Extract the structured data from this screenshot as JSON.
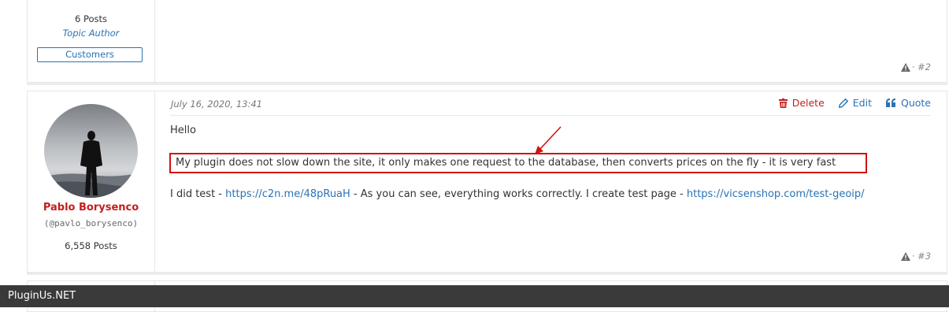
{
  "post_prev": {
    "posts_count": "6 Posts",
    "role": "Topic Author",
    "badge": "Customers",
    "number": "· #2"
  },
  "post_main": {
    "date": "July 16, 2020, 13:41",
    "actions": {
      "delete": "Delete",
      "edit": "Edit",
      "quote": "Quote"
    },
    "author": {
      "name": "Pablo Borysenco",
      "handle": "(@pavlo_borysenco)",
      "posts_count": "6,558 Posts"
    },
    "content": {
      "line1": "Hello",
      "highlighted": "My plugin does not slow down the site, it only makes one request to the database, then converts prices on the fly - it is very fast",
      "line3_a": "I did  test  - ",
      "link1": "https://c2n.me/48pRuaH",
      "line3_b": " - As you can see, everything works correctly.  I create  test  page - ",
      "link2": "https://vicsenshop.com/test-geoip/"
    },
    "number": "· #3"
  },
  "footer": {
    "brand": "PluginUs.NET"
  },
  "colors": {
    "accent": "#2a73b4",
    "danger": "#c41e1e",
    "annotation": "#d11212",
    "bar": "#3a3a3a"
  }
}
